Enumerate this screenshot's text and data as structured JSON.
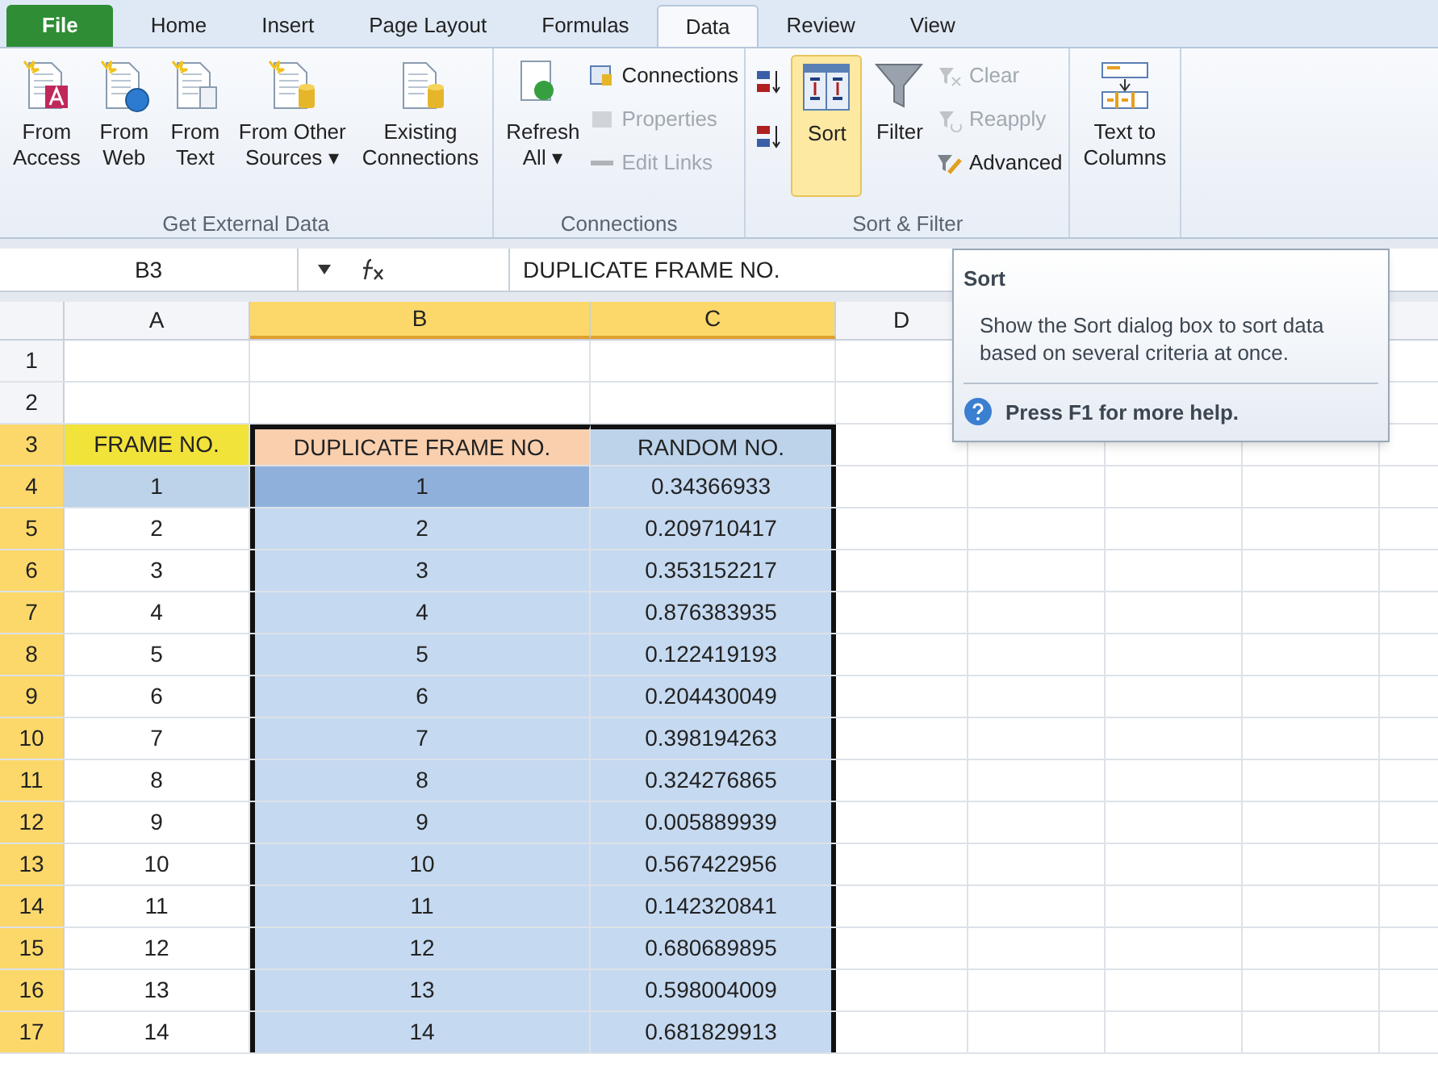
{
  "tabs": [
    {
      "label": "File",
      "kind": "file",
      "selected": false
    },
    {
      "label": "Home",
      "kind": "tab",
      "selected": false
    },
    {
      "label": "Insert",
      "kind": "tab",
      "selected": false
    },
    {
      "label": "Page Layout",
      "kind": "tab",
      "selected": false
    },
    {
      "label": "Formulas",
      "kind": "tab",
      "selected": false
    },
    {
      "label": "Data",
      "kind": "tab",
      "selected": true
    },
    {
      "label": "Review",
      "kind": "tab",
      "selected": false
    },
    {
      "label": "View",
      "kind": "tab",
      "selected": false
    }
  ],
  "ribbon_groups": [
    {
      "label": "Get External Data",
      "items": [
        {
          "kind": "large",
          "label": [
            "From",
            "Access"
          ],
          "disabled": false,
          "selected": false
        },
        {
          "kind": "large",
          "label": [
            "From",
            "Web"
          ],
          "disabled": false,
          "selected": false
        },
        {
          "kind": "large",
          "label": [
            "From",
            "Text"
          ],
          "disabled": false,
          "selected": false
        },
        {
          "kind": "large",
          "label": [
            "From Other",
            "Sources ▾"
          ],
          "disabled": false,
          "selected": false
        },
        {
          "kind": "large",
          "label": [
            "Existing",
            "Connections"
          ],
          "disabled": false,
          "selected": false
        }
      ]
    },
    {
      "label": "Connections",
      "items": [
        {
          "kind": "large",
          "label": [
            "Refresh",
            "All ▾"
          ],
          "disabled": false,
          "selected": false
        },
        {
          "kind": "stack",
          "items": [
            {
              "label": "Connections",
              "disabled": false
            },
            {
              "label": "Properties",
              "disabled": true
            },
            {
              "label": "Edit Links",
              "disabled": true
            }
          ]
        }
      ]
    },
    {
      "label": "Sort & Filter",
      "items": [
        {
          "kind": "iconstack",
          "items": [
            {
              "kind": "ascending"
            },
            {
              "kind": "descending"
            }
          ]
        },
        {
          "kind": "large",
          "label": [
            "Sort"
          ],
          "disabled": false,
          "selected": true
        },
        {
          "kind": "large",
          "label": [
            "Filter"
          ],
          "disabled": false,
          "selected": false
        },
        {
          "kind": "stack",
          "items": [
            {
              "label": "Clear",
              "disabled": true
            },
            {
              "label": "Reapply",
              "disabled": true
            },
            {
              "label": "Advanced",
              "disabled": false
            }
          ]
        }
      ]
    },
    {
      "items": [
        {
          "kind": "large",
          "label": [
            "Text to",
            "Columns"
          ],
          "disabled": false,
          "selected": false
        }
      ]
    }
  ],
  "name_box": "B3",
  "formula": "DUPLICATE FRAME NO.",
  "columns": [
    {
      "label": "A",
      "selected": false
    },
    {
      "label": "B",
      "selected": true
    },
    {
      "label": "C",
      "selected": true
    },
    {
      "label": "D",
      "selected": false
    }
  ],
  "rows": [
    {
      "number": "1",
      "selected": false,
      "cells": [
        {
          "text": ""
        },
        {
          "text": ""
        },
        {
          "text": ""
        }
      ]
    },
    {
      "number": "2",
      "selected": false,
      "cells": [
        {
          "text": ""
        },
        {
          "text": ""
        },
        {
          "text": ""
        }
      ]
    },
    {
      "number": "3",
      "selected": true,
      "cells": [
        {
          "text": "FRAME NO.",
          "color": "#f2e33a"
        },
        {
          "text": "DUPLICATE FRAME NO.",
          "color": "#f9cfae"
        },
        {
          "text": "RANDOM NO.",
          "color": "#bcd3ea"
        }
      ]
    },
    {
      "number": "4",
      "selected": true,
      "cells": [
        {
          "text": "1",
          "color": "#bcd3ea"
        },
        {
          "text": "1",
          "color": "#8fb0db"
        },
        {
          "text": "0.34366933",
          "color": "#c5d9f0"
        }
      ]
    },
    {
      "number": "5",
      "selected": true,
      "cells": [
        {
          "text": "2"
        },
        {
          "text": "2",
          "color": "#c5d9f0"
        },
        {
          "text": "0.209710417",
          "color": "#c5d9f0"
        }
      ]
    },
    {
      "number": "6",
      "selected": true,
      "cells": [
        {
          "text": "3"
        },
        {
          "text": "3",
          "color": "#c5d9f0"
        },
        {
          "text": "0.353152217",
          "color": "#c5d9f0"
        }
      ]
    },
    {
      "number": "7",
      "selected": true,
      "cells": [
        {
          "text": "4"
        },
        {
          "text": "4",
          "color": "#c5d9f0"
        },
        {
          "text": "0.876383935",
          "color": "#c5d9f0"
        }
      ]
    },
    {
      "number": "8",
      "selected": true,
      "cells": [
        {
          "text": "5"
        },
        {
          "text": "5",
          "color": "#c5d9f0"
        },
        {
          "text": "0.122419193",
          "color": "#c5d9f0"
        }
      ]
    },
    {
      "number": "9",
      "selected": true,
      "cells": [
        {
          "text": "6"
        },
        {
          "text": "6",
          "color": "#c5d9f0"
        },
        {
          "text": "0.204430049",
          "color": "#c5d9f0"
        }
      ]
    },
    {
      "number": "10",
      "selected": true,
      "cells": [
        {
          "text": "7"
        },
        {
          "text": "7",
          "color": "#c5d9f0"
        },
        {
          "text": "0.398194263",
          "color": "#c5d9f0"
        }
      ]
    },
    {
      "number": "11",
      "selected": true,
      "cells": [
        {
          "text": "8"
        },
        {
          "text": "8",
          "color": "#c5d9f0"
        },
        {
          "text": "0.324276865",
          "color": "#c5d9f0"
        }
      ]
    },
    {
      "number": "12",
      "selected": true,
      "cells": [
        {
          "text": "9"
        },
        {
          "text": "9",
          "color": "#c5d9f0"
        },
        {
          "text": "0.005889939",
          "color": "#c5d9f0"
        }
      ]
    },
    {
      "number": "13",
      "selected": true,
      "cells": [
        {
          "text": "10"
        },
        {
          "text": "10",
          "color": "#c5d9f0"
        },
        {
          "text": "0.567422956",
          "color": "#c5d9f0"
        }
      ]
    },
    {
      "number": "14",
      "selected": true,
      "cells": [
        {
          "text": "11"
        },
        {
          "text": "11",
          "color": "#c5d9f0"
        },
        {
          "text": "0.142320841",
          "color": "#c5d9f0"
        }
      ]
    },
    {
      "number": "15",
      "selected": true,
      "cells": [
        {
          "text": "12"
        },
        {
          "text": "12",
          "color": "#c5d9f0"
        },
        {
          "text": "0.680689895",
          "color": "#c5d9f0"
        }
      ]
    },
    {
      "number": "16",
      "selected": true,
      "cells": [
        {
          "text": "13"
        },
        {
          "text": "13",
          "color": "#c5d9f0"
        },
        {
          "text": "0.598004009",
          "color": "#c5d9f0"
        }
      ]
    },
    {
      "number": "17",
      "selected": true,
      "cells": [
        {
          "text": "14"
        },
        {
          "text": "14",
          "color": "#c5d9f0"
        },
        {
          "text": "0.681829913",
          "color": "#c5d9f0"
        }
      ]
    }
  ],
  "tooltip": {
    "title": "Sort",
    "body": "Show the Sort dialog box to sort data based on several criteria at once.",
    "help": "Press F1 for more help."
  }
}
